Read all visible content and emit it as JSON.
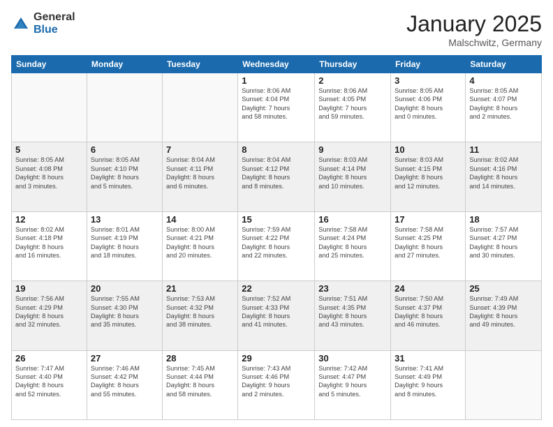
{
  "logo": {
    "general": "General",
    "blue": "Blue"
  },
  "title": "January 2025",
  "subtitle": "Malschwitz, Germany",
  "headers": [
    "Sunday",
    "Monday",
    "Tuesday",
    "Wednesday",
    "Thursday",
    "Friday",
    "Saturday"
  ],
  "weeks": [
    [
      {
        "day": "",
        "lines": []
      },
      {
        "day": "",
        "lines": []
      },
      {
        "day": "",
        "lines": []
      },
      {
        "day": "1",
        "lines": [
          "Sunrise: 8:06 AM",
          "Sunset: 4:04 PM",
          "Daylight: 7 hours",
          "and 58 minutes."
        ]
      },
      {
        "day": "2",
        "lines": [
          "Sunrise: 8:06 AM",
          "Sunset: 4:05 PM",
          "Daylight: 7 hours",
          "and 59 minutes."
        ]
      },
      {
        "day": "3",
        "lines": [
          "Sunrise: 8:05 AM",
          "Sunset: 4:06 PM",
          "Daylight: 8 hours",
          "and 0 minutes."
        ]
      },
      {
        "day": "4",
        "lines": [
          "Sunrise: 8:05 AM",
          "Sunset: 4:07 PM",
          "Daylight: 8 hours",
          "and 2 minutes."
        ]
      }
    ],
    [
      {
        "day": "5",
        "lines": [
          "Sunrise: 8:05 AM",
          "Sunset: 4:08 PM",
          "Daylight: 8 hours",
          "and 3 minutes."
        ]
      },
      {
        "day": "6",
        "lines": [
          "Sunrise: 8:05 AM",
          "Sunset: 4:10 PM",
          "Daylight: 8 hours",
          "and 5 minutes."
        ]
      },
      {
        "day": "7",
        "lines": [
          "Sunrise: 8:04 AM",
          "Sunset: 4:11 PM",
          "Daylight: 8 hours",
          "and 6 minutes."
        ]
      },
      {
        "day": "8",
        "lines": [
          "Sunrise: 8:04 AM",
          "Sunset: 4:12 PM",
          "Daylight: 8 hours",
          "and 8 minutes."
        ]
      },
      {
        "day": "9",
        "lines": [
          "Sunrise: 8:03 AM",
          "Sunset: 4:14 PM",
          "Daylight: 8 hours",
          "and 10 minutes."
        ]
      },
      {
        "day": "10",
        "lines": [
          "Sunrise: 8:03 AM",
          "Sunset: 4:15 PM",
          "Daylight: 8 hours",
          "and 12 minutes."
        ]
      },
      {
        "day": "11",
        "lines": [
          "Sunrise: 8:02 AM",
          "Sunset: 4:16 PM",
          "Daylight: 8 hours",
          "and 14 minutes."
        ]
      }
    ],
    [
      {
        "day": "12",
        "lines": [
          "Sunrise: 8:02 AM",
          "Sunset: 4:18 PM",
          "Daylight: 8 hours",
          "and 16 minutes."
        ]
      },
      {
        "day": "13",
        "lines": [
          "Sunrise: 8:01 AM",
          "Sunset: 4:19 PM",
          "Daylight: 8 hours",
          "and 18 minutes."
        ]
      },
      {
        "day": "14",
        "lines": [
          "Sunrise: 8:00 AM",
          "Sunset: 4:21 PM",
          "Daylight: 8 hours",
          "and 20 minutes."
        ]
      },
      {
        "day": "15",
        "lines": [
          "Sunrise: 7:59 AM",
          "Sunset: 4:22 PM",
          "Daylight: 8 hours",
          "and 22 minutes."
        ]
      },
      {
        "day": "16",
        "lines": [
          "Sunrise: 7:58 AM",
          "Sunset: 4:24 PM",
          "Daylight: 8 hours",
          "and 25 minutes."
        ]
      },
      {
        "day": "17",
        "lines": [
          "Sunrise: 7:58 AM",
          "Sunset: 4:25 PM",
          "Daylight: 8 hours",
          "and 27 minutes."
        ]
      },
      {
        "day": "18",
        "lines": [
          "Sunrise: 7:57 AM",
          "Sunset: 4:27 PM",
          "Daylight: 8 hours",
          "and 30 minutes."
        ]
      }
    ],
    [
      {
        "day": "19",
        "lines": [
          "Sunrise: 7:56 AM",
          "Sunset: 4:29 PM",
          "Daylight: 8 hours",
          "and 32 minutes."
        ]
      },
      {
        "day": "20",
        "lines": [
          "Sunrise: 7:55 AM",
          "Sunset: 4:30 PM",
          "Daylight: 8 hours",
          "and 35 minutes."
        ]
      },
      {
        "day": "21",
        "lines": [
          "Sunrise: 7:53 AM",
          "Sunset: 4:32 PM",
          "Daylight: 8 hours",
          "and 38 minutes."
        ]
      },
      {
        "day": "22",
        "lines": [
          "Sunrise: 7:52 AM",
          "Sunset: 4:33 PM",
          "Daylight: 8 hours",
          "and 41 minutes."
        ]
      },
      {
        "day": "23",
        "lines": [
          "Sunrise: 7:51 AM",
          "Sunset: 4:35 PM",
          "Daylight: 8 hours",
          "and 43 minutes."
        ]
      },
      {
        "day": "24",
        "lines": [
          "Sunrise: 7:50 AM",
          "Sunset: 4:37 PM",
          "Daylight: 8 hours",
          "and 46 minutes."
        ]
      },
      {
        "day": "25",
        "lines": [
          "Sunrise: 7:49 AM",
          "Sunset: 4:39 PM",
          "Daylight: 8 hours",
          "and 49 minutes."
        ]
      }
    ],
    [
      {
        "day": "26",
        "lines": [
          "Sunrise: 7:47 AM",
          "Sunset: 4:40 PM",
          "Daylight: 8 hours",
          "and 52 minutes."
        ]
      },
      {
        "day": "27",
        "lines": [
          "Sunrise: 7:46 AM",
          "Sunset: 4:42 PM",
          "Daylight: 8 hours",
          "and 55 minutes."
        ]
      },
      {
        "day": "28",
        "lines": [
          "Sunrise: 7:45 AM",
          "Sunset: 4:44 PM",
          "Daylight: 8 hours",
          "and 58 minutes."
        ]
      },
      {
        "day": "29",
        "lines": [
          "Sunrise: 7:43 AM",
          "Sunset: 4:46 PM",
          "Daylight: 9 hours",
          "and 2 minutes."
        ]
      },
      {
        "day": "30",
        "lines": [
          "Sunrise: 7:42 AM",
          "Sunset: 4:47 PM",
          "Daylight: 9 hours",
          "and 5 minutes."
        ]
      },
      {
        "day": "31",
        "lines": [
          "Sunrise: 7:41 AM",
          "Sunset: 4:49 PM",
          "Daylight: 9 hours",
          "and 8 minutes."
        ]
      },
      {
        "day": "",
        "lines": []
      }
    ]
  ]
}
